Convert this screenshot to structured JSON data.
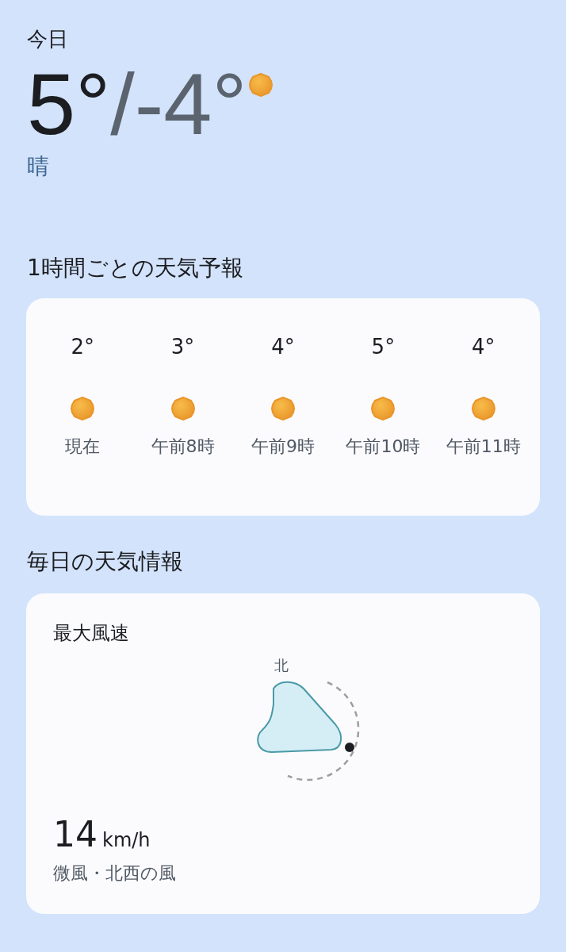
{
  "today": {
    "label": "今日",
    "high": "5°",
    "separator": "/",
    "low": "-4°",
    "condition": "晴"
  },
  "hourly": {
    "title": "1時間ごとの天気予報",
    "items": [
      {
        "temp": "2°",
        "time": "現在"
      },
      {
        "temp": "3°",
        "time": "午前8時"
      },
      {
        "temp": "4°",
        "time": "午前9時"
      },
      {
        "temp": "5°",
        "time": "午前10時"
      },
      {
        "temp": "4°",
        "time": "午前11時"
      }
    ]
  },
  "daily": {
    "title": "毎日の天気情報",
    "wind": {
      "title": "最大風速",
      "direction_label": "北",
      "speed": "14",
      "unit": "km/h",
      "description": "微風・北西の風"
    }
  }
}
